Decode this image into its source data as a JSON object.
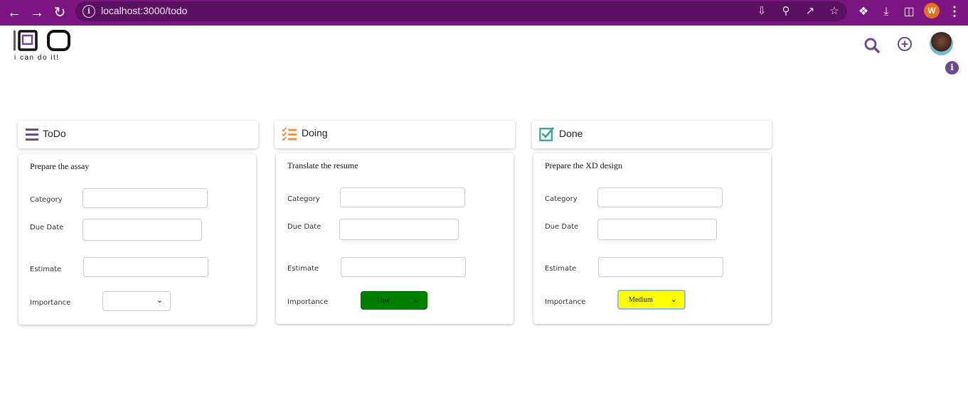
{
  "browser": {
    "url": "localhost:3000/todo",
    "profile_initial": "W",
    "bar_color": "#7b1581"
  },
  "app": {
    "logo_text": "IDO",
    "logo_tagline": "i can do it!",
    "accent_color": "#6b4b8c"
  },
  "columns": [
    {
      "title": "ToDo",
      "icon": "hamburger-list-icon",
      "card": {
        "title": "Prepare the assay",
        "category_label": "Category",
        "category_value": "",
        "due_date_label": "Due Date",
        "due_date_value": "",
        "estimate_label": "Estimate",
        "estimate_value": "",
        "importance_label": "Importance",
        "importance_value": "",
        "importance_color": "#ffffff"
      }
    },
    {
      "title": "Doing",
      "icon": "checklist-icon",
      "card": {
        "title": "Translate the resume",
        "category_label": "Category",
        "category_value": "",
        "due_date_label": "Due Date",
        "due_date_value": "",
        "estimate_label": "Estimate",
        "estimate_value": "",
        "importance_label": "Importance",
        "importance_value": "Low",
        "importance_color": "#008000"
      }
    },
    {
      "title": "Done",
      "icon": "checkbox-checked-icon",
      "card": {
        "title": "Prepare the XD design",
        "category_label": "Category",
        "category_value": "",
        "due_date_label": "Due Date",
        "due_date_value": "",
        "estimate_label": "Estimate",
        "estimate_value": "",
        "importance_label": "Importance",
        "importance_value": "Medium",
        "importance_color": "#ffff00"
      }
    }
  ]
}
